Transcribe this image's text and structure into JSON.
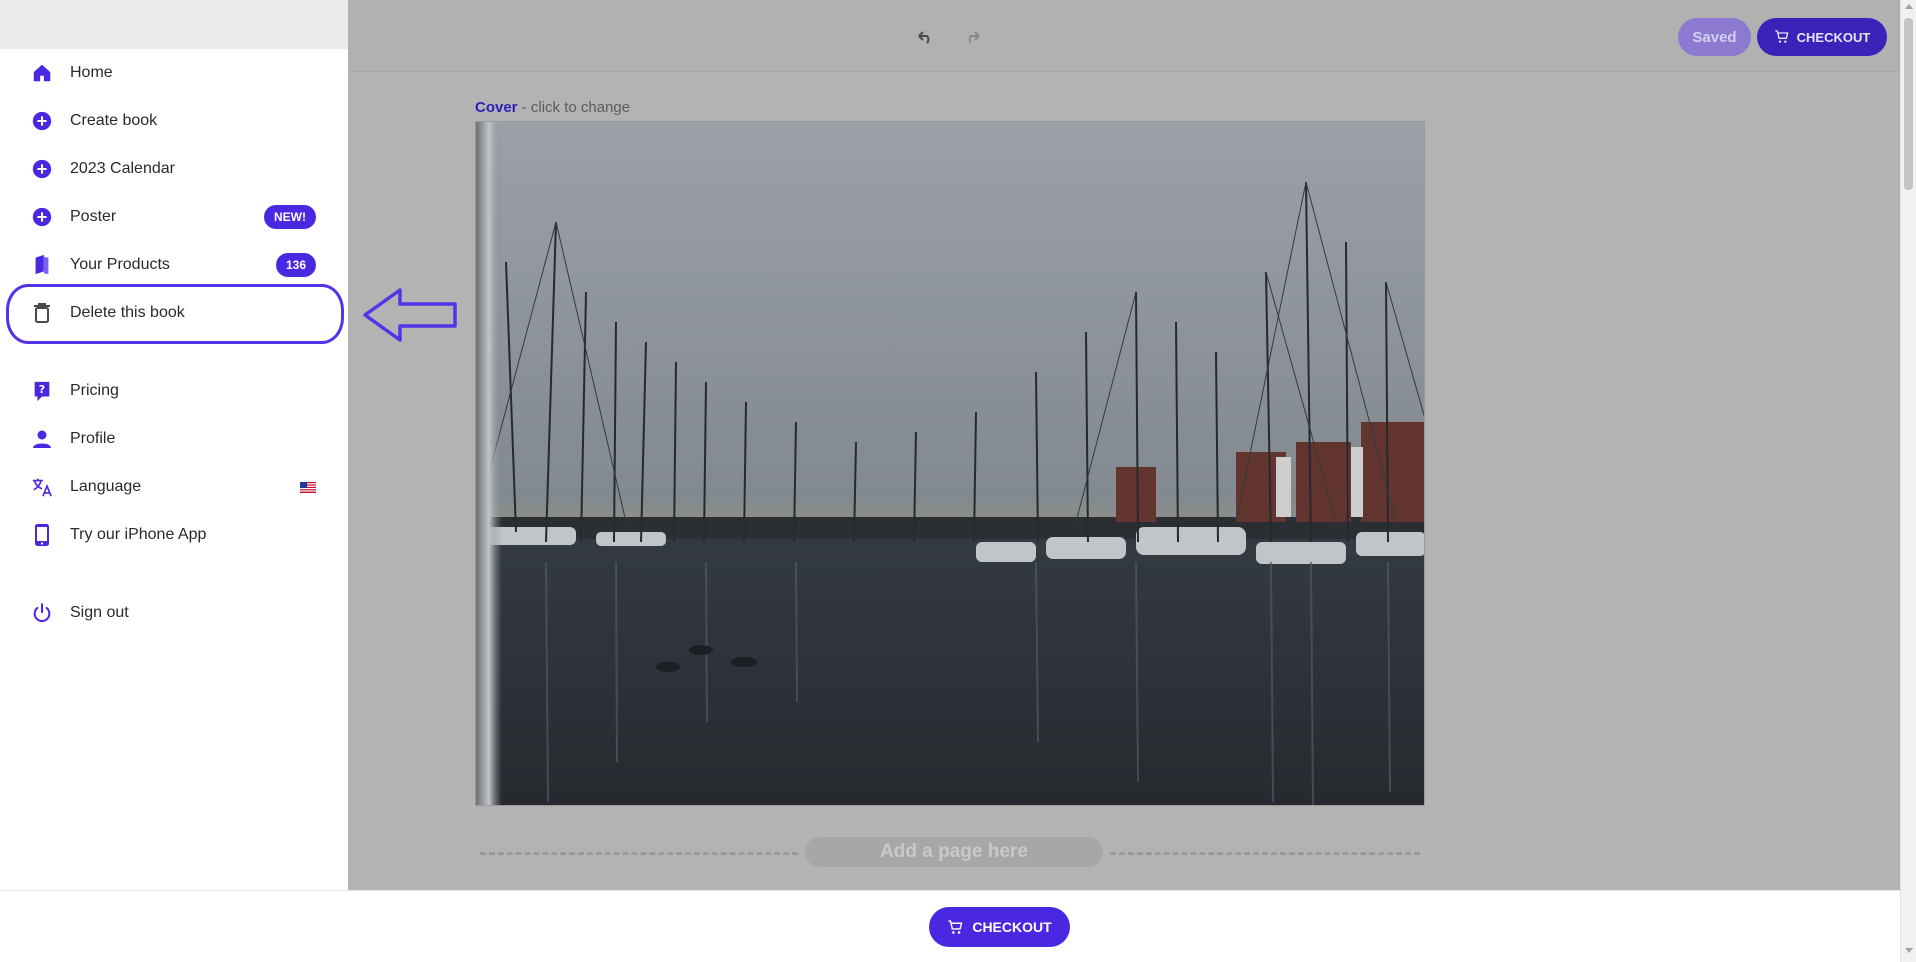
{
  "toolbar": {
    "undo_icon": "undo-icon",
    "redo_icon": "redo-icon",
    "saved_label": "Saved",
    "checkout_label": "CHECKOUT"
  },
  "cover": {
    "label": "Cover",
    "hint": " - click to change",
    "image": "harbor-photo-sailboat-masts"
  },
  "add_page": {
    "label": "Add a page here"
  },
  "sidebar": {
    "items": [
      {
        "label": "Home",
        "icon": "home-icon"
      },
      {
        "label": "Create book",
        "icon": "plus-circle-icon"
      },
      {
        "label": "2023 Calendar",
        "icon": "plus-circle-icon"
      },
      {
        "label": "Poster",
        "icon": "plus-circle-icon",
        "badge": "NEW!"
      },
      {
        "label": "Your Products",
        "icon": "book-icon",
        "badge": "136"
      },
      {
        "label": "Delete this book",
        "icon": "trash-icon"
      },
      {
        "label": "Pricing",
        "icon": "help-icon"
      },
      {
        "label": "Profile",
        "icon": "person-icon"
      },
      {
        "label": "Language",
        "icon": "translate-icon",
        "flag": "us-flag"
      },
      {
        "label": "Try our iPhone App",
        "icon": "phone-icon"
      },
      {
        "label": "Sign out",
        "icon": "power-icon"
      }
    ]
  },
  "bottombar": {
    "checkout_label": "CHECKOUT"
  },
  "colors": {
    "accent": "#4a27e0",
    "accent_dark": "#3b22b8",
    "highlight": "#5533e8"
  }
}
